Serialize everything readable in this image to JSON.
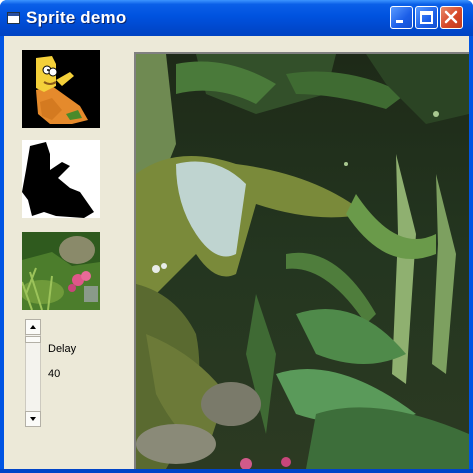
{
  "window": {
    "title": "Sprite demo"
  },
  "titlebar_buttons": [
    "minimize",
    "maximize",
    "close"
  ],
  "images": {
    "sprite": "bart-simpson-sprite",
    "mask": "sprite-mask",
    "background": "jungle-background-thumbnail",
    "stage": "jungle-plants-scene"
  },
  "controls": {
    "delay_label": "Delay",
    "delay_value": "40"
  },
  "colors": {
    "titlebar": "#0054e3",
    "client": "#ece9d8",
    "close_button": "#d6482a"
  }
}
